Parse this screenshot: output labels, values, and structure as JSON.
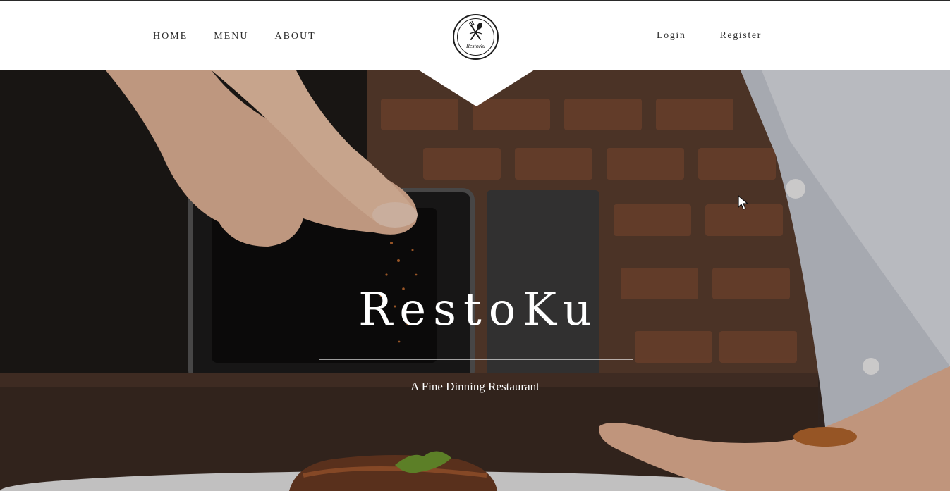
{
  "brand": {
    "name": "RestoKu",
    "logo_text": "RestoKu",
    "tagline": "A Fine Dinning Restaurant"
  },
  "nav": {
    "left": [
      {
        "label": "HOME"
      },
      {
        "label": "MENU"
      },
      {
        "label": "ABOUT"
      }
    ],
    "right": [
      {
        "label": "Login"
      },
      {
        "label": "Register"
      }
    ]
  },
  "icons": {
    "logo": "fork-spoon-emblem-icon",
    "cursor": "mouse-pointer-icon"
  },
  "colors": {
    "header_bg": "#ffffff",
    "nav_text": "#2b2b2b",
    "hero_text": "#ffffff"
  }
}
